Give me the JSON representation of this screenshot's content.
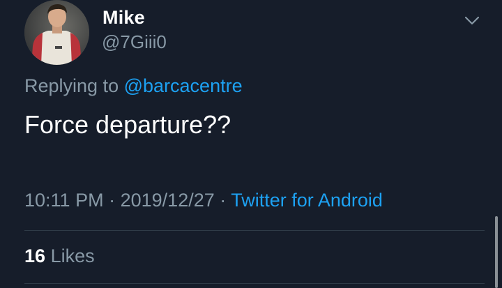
{
  "user": {
    "name": "Mike",
    "handle": "@7Giii0"
  },
  "reply": {
    "prefix": "Replying to",
    "mention": "@barcacentre"
  },
  "tweet": {
    "text": "Force departure??"
  },
  "meta": {
    "time": "10:11 PM",
    "separator1": "·",
    "date": "2019/12/27",
    "separator2": "·",
    "source": "Twitter for Android"
  },
  "stats": {
    "likes_count": "16",
    "likes_label": "Likes"
  },
  "colors": {
    "background": "#161d2a",
    "primary_text": "#ffffff",
    "secondary_text": "#8899a6",
    "accent": "#1da1f2"
  },
  "icons": {
    "menu": "chevron-down-icon"
  }
}
